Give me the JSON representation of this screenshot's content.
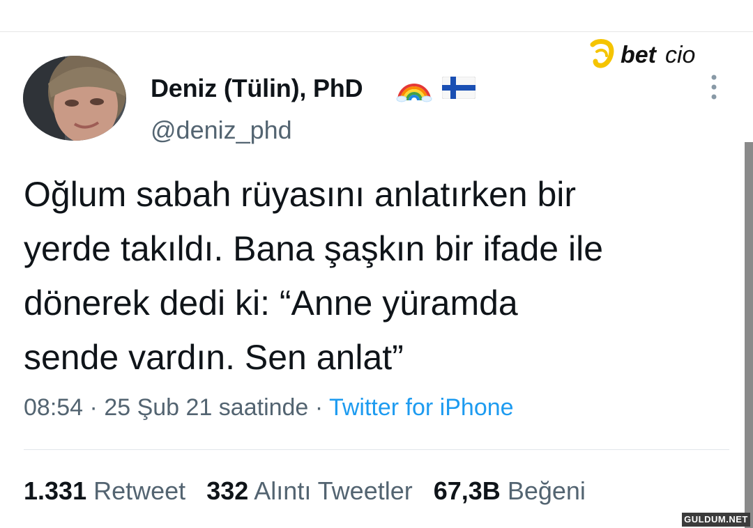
{
  "tweet": {
    "author_name": "Deniz (Tülin), PhD",
    "handle": "@deniz_phd",
    "emoji_after_name": [
      "rainbow",
      "flag-finland"
    ],
    "text_lines": [
      "Oğlum sabah rüyasını anlatırken bir",
      "yerde takıldı. Bana şaşkın bir ifade ile",
      "dönerek dedi ki: “Anne yüramda",
      "sende vardın. Sen anlat”"
    ],
    "time": "08:54",
    "date": "25 Şub 21 saatinde",
    "separator": "·",
    "source": "Twitter for iPhone"
  },
  "stats": {
    "retweets_count": "1.331",
    "retweets_label": "Retweet",
    "quotes_count": "332",
    "quotes_label": "Alıntı Tweetler",
    "likes_count": "67,3B",
    "likes_label": "Beğeni"
  },
  "icons": {
    "more": "more-vertical-icon",
    "rainbow": "rainbow-icon",
    "flag": "finland-flag-icon"
  },
  "logo_text": "betcio",
  "watermark_text": "GULDUM.NET",
  "colors": {
    "text_primary": "#0f1419",
    "text_secondary": "#536471",
    "link": "#1d9bf0",
    "logo_accent": "#f5c400"
  }
}
